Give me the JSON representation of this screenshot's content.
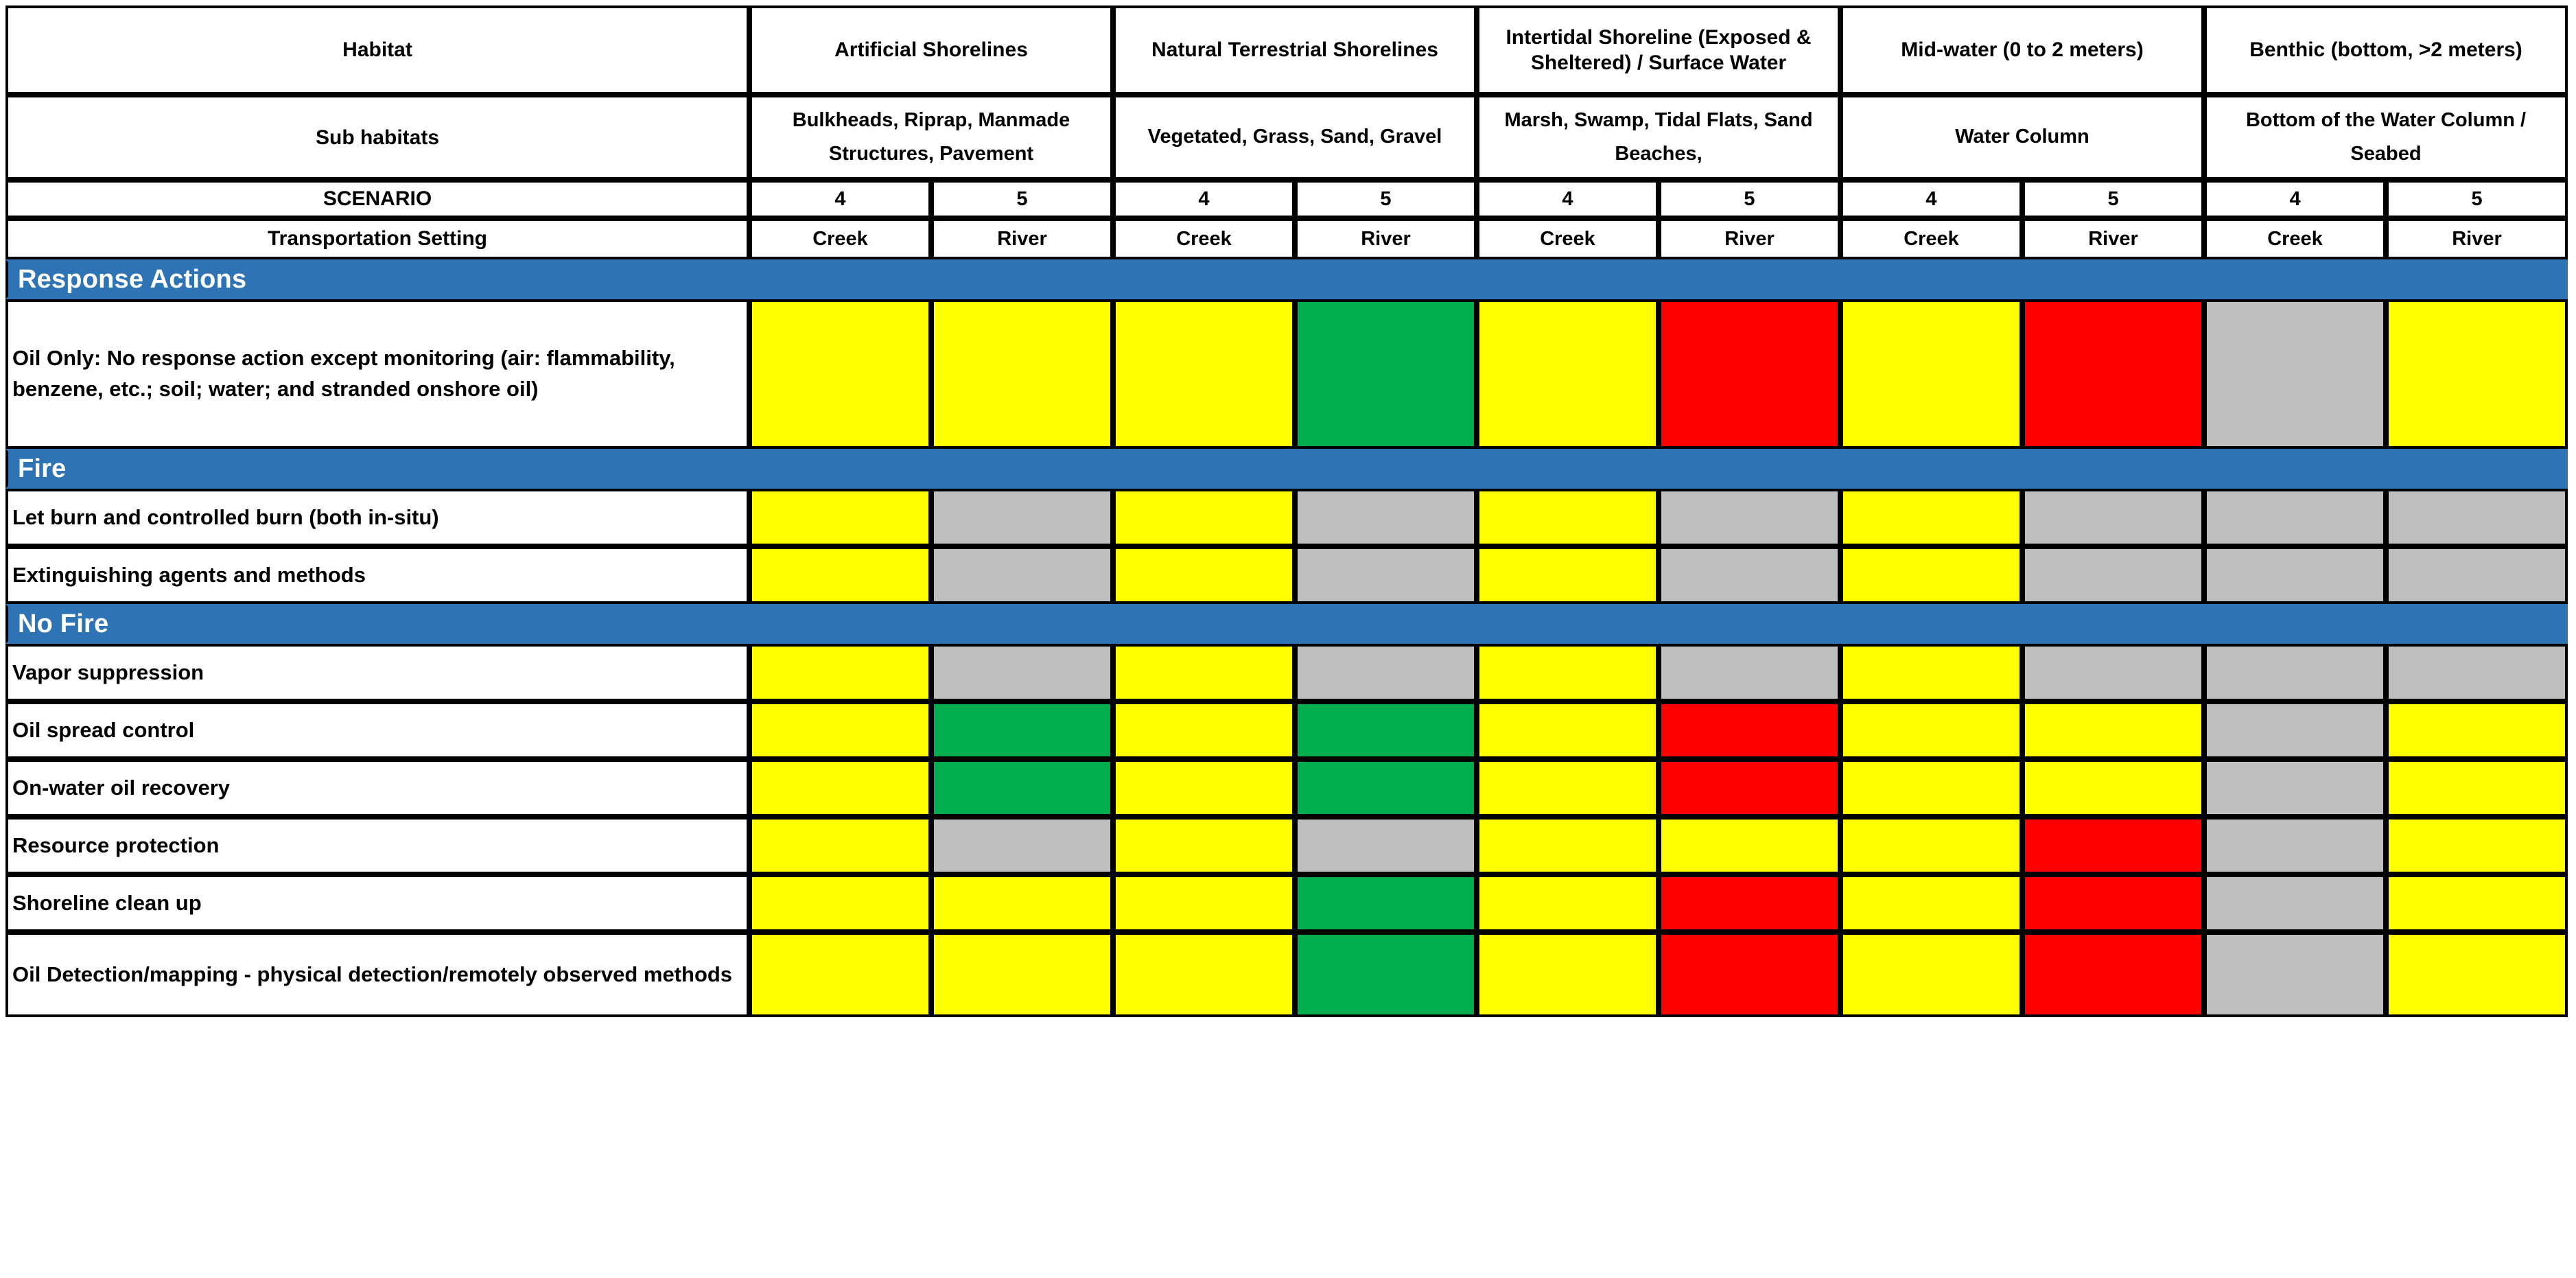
{
  "table": {
    "row_headers": {
      "habitat": "Habitat",
      "sub_habitats": "Sub habitats",
      "scenario": "SCENARIO",
      "transportation_setting": "Transportation Setting"
    },
    "habitats": [
      "Artificial Shorelines",
      "Natural Terrestrial Shorelines",
      "Intertidal Shoreline (Exposed & Sheltered) / Surface Water",
      "Mid-water (0 to 2 meters)",
      "Benthic (bottom, >2 meters)"
    ],
    "sub_habitats": [
      "Bulkheads, Riprap, Manmade Structures, Pavement",
      "Vegetated, Grass, Sand, Gravel",
      "Marsh, Swamp, Tidal Flats, Sand Beaches,",
      "Water Column",
      "Bottom of the Water Column / Seabed"
    ],
    "scenarios": [
      "4",
      "5",
      "4",
      "5",
      "4",
      "5",
      "4",
      "5",
      "4",
      "5"
    ],
    "transportation_settings": [
      "Creek",
      "River",
      "Creek",
      "River",
      "Creek",
      "River",
      "Creek",
      "River",
      "Creek",
      "River"
    ],
    "sections": [
      {
        "title": "Response Actions",
        "rows": [
          {
            "label": "Oil Only: No response action except monitoring (air: flammability, benzene, etc.; soil;  water; and stranded onshore oil)",
            "cells": [
              "yellow",
              "yellow",
              "yellow",
              "green",
              "yellow",
              "red",
              "yellow",
              "red",
              "grey",
              "yellow"
            ]
          }
        ]
      },
      {
        "title": "Fire",
        "rows": [
          {
            "label": "Let burn and controlled burn (both in-situ)",
            "cells": [
              "yellow",
              "grey",
              "yellow",
              "grey",
              "yellow",
              "grey",
              "yellow",
              "grey",
              "grey",
              "grey"
            ]
          },
          {
            "label": "Extinguishing agents and methods",
            "cells": [
              "yellow",
              "grey",
              "yellow",
              "grey",
              "yellow",
              "grey",
              "yellow",
              "grey",
              "grey",
              "grey"
            ]
          }
        ]
      },
      {
        "title": "No Fire",
        "rows": [
          {
            "label": "Vapor suppression",
            "cells": [
              "yellow",
              "grey",
              "yellow",
              "grey",
              "yellow",
              "grey",
              "yellow",
              "grey",
              "grey",
              "grey"
            ]
          },
          {
            "label": "Oil spread control",
            "cells": [
              "yellow",
              "green",
              "yellow",
              "green",
              "yellow",
              "red",
              "yellow",
              "yellow",
              "grey",
              "yellow"
            ]
          },
          {
            "label": "On-water oil recovery",
            "cells": [
              "yellow",
              "green",
              "yellow",
              "green",
              "yellow",
              "red",
              "yellow",
              "yellow",
              "grey",
              "yellow"
            ]
          },
          {
            "label": "Resource protection",
            "cells": [
              "yellow",
              "grey",
              "yellow",
              "grey",
              "yellow",
              "yellow",
              "yellow",
              "red",
              "grey",
              "yellow"
            ]
          },
          {
            "label": "Shoreline clean up",
            "cells": [
              "yellow",
              "yellow",
              "yellow",
              "green",
              "yellow",
              "red",
              "yellow",
              "red",
              "grey",
              "yellow"
            ]
          },
          {
            "label": "Oil Detection/mapping - physical detection/remotely observed methods",
            "cells": [
              "yellow",
              "yellow",
              "yellow",
              "green",
              "yellow",
              "red",
              "yellow",
              "red",
              "grey",
              "yellow"
            ]
          }
        ]
      }
    ]
  },
  "colors": {
    "yellow": "#FFFF00",
    "green": "#00AE4D",
    "red": "#FF0000",
    "grey": "#BFBFBF",
    "section_blue": "#2E74B5",
    "border": "#000000"
  }
}
